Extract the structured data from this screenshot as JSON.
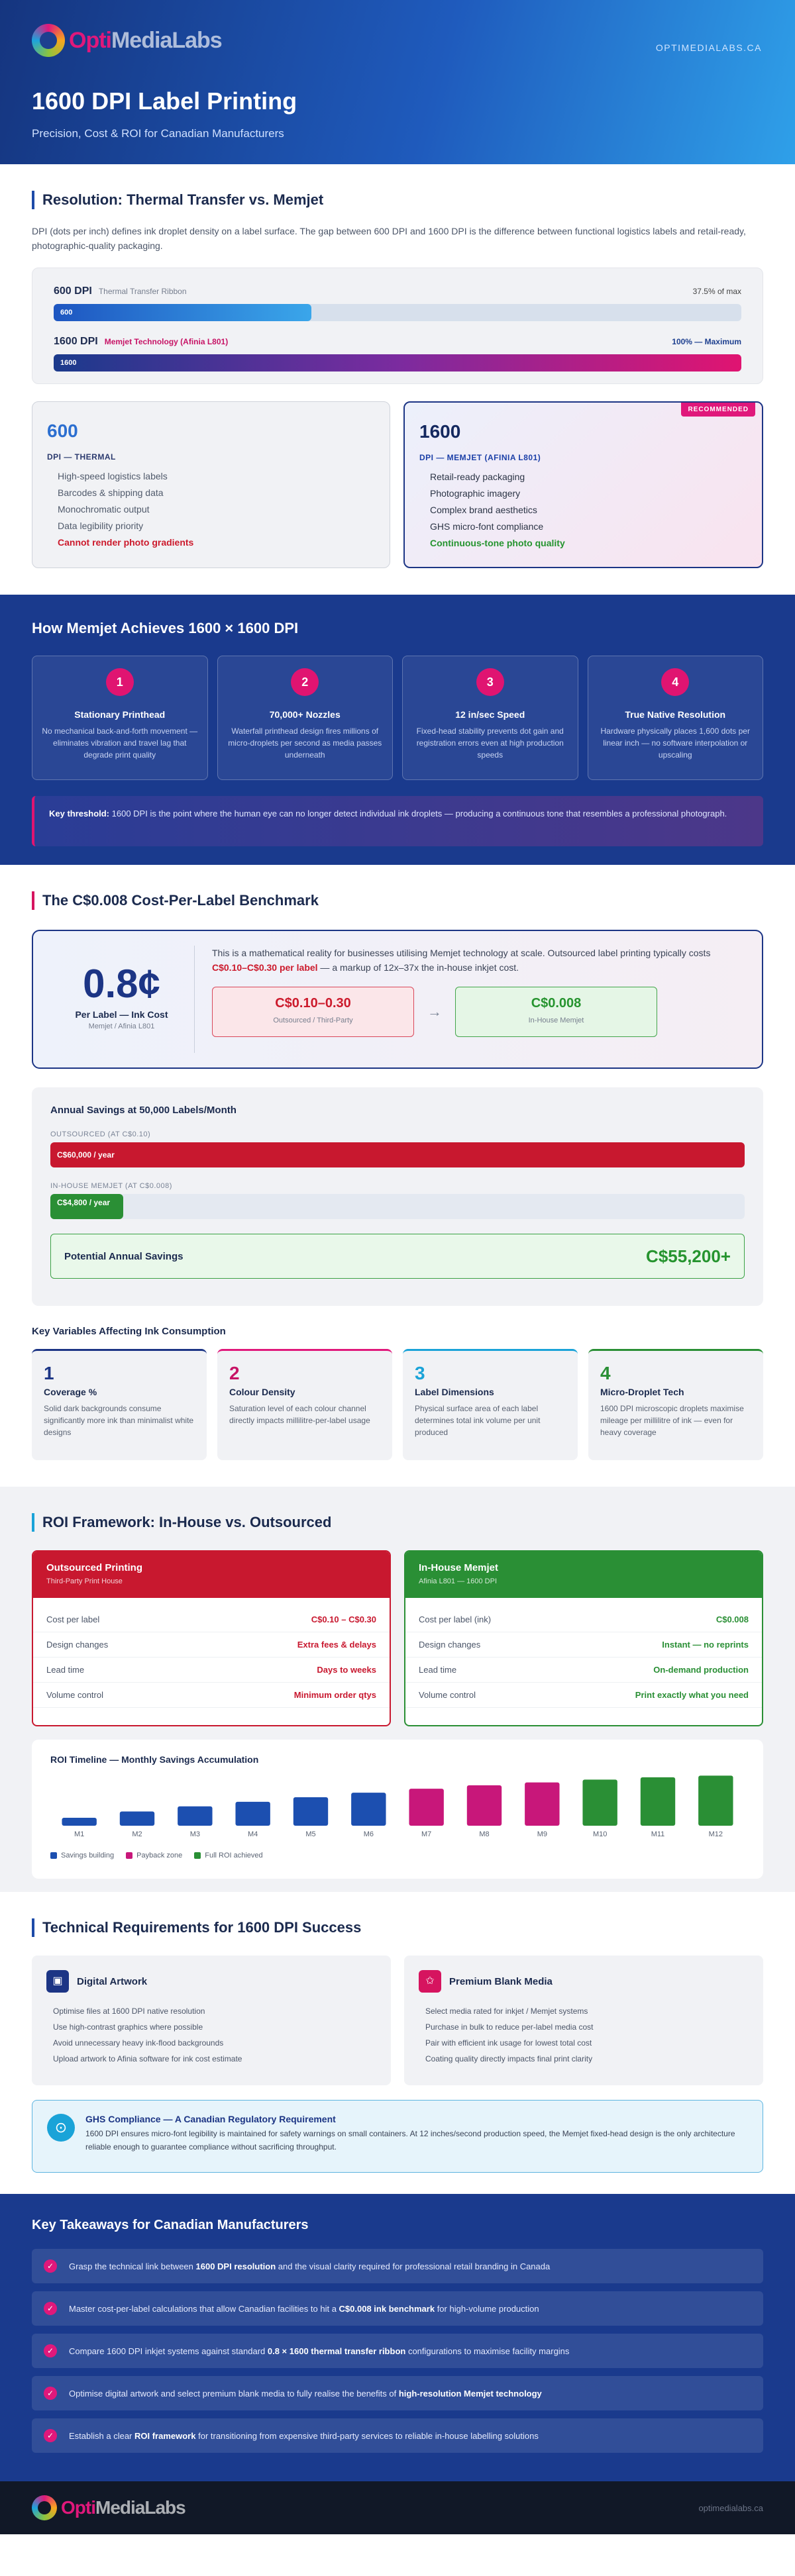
{
  "brand": {
    "logo_a": "Opti",
    "logo_b": "MediaLabs",
    "url": "OPTIMEDIALABS.CA",
    "footer_url": "optimedialabs.ca"
  },
  "hero": {
    "title": "1600 DPI Label Printing",
    "subtitle": "Precision, Cost & ROI for Canadian Manufacturers"
  },
  "resolution": {
    "heading": "Resolution: Thermal Transfer vs. Memjet",
    "intro": "DPI (dots per inch) defines ink droplet density on a label surface. The gap between 600 DPI and 1600 DPI is the difference between functional logistics labels and retail-ready, photographic-quality packaging.",
    "bars": [
      {
        "label": "600 DPI",
        "sub": "Thermal Transfer Ribbon",
        "right": "37.5% of max",
        "fill_text": "600",
        "fraction": 0.375
      },
      {
        "label": "1600 DPI",
        "sub": "Memjet Technology (Afinia L801)",
        "right": "100% — Maximum",
        "fill_text": "1600",
        "fraction": 1.0
      }
    ],
    "card600": {
      "num": "600",
      "tag": "DPI — THERMAL",
      "items": [
        "High-speed logistics labels",
        "Barcodes & shipping data",
        "Monochromatic output",
        "Data legibility priority"
      ],
      "bad": "Cannot render photo gradients"
    },
    "card1600": {
      "ribbon": "RECOMMENDED",
      "num": "1600",
      "tag": "DPI — MEMJET (AFINIA L801)",
      "items": [
        "Retail-ready packaging",
        "Photographic imagery",
        "Complex brand aesthetics",
        "GHS micro-font compliance"
      ],
      "good": "Continuous-tone photo quality"
    }
  },
  "memjet": {
    "heading": "How Memjet Achieves 1600 × 1600 DPI",
    "steps": [
      {
        "n": "1",
        "title": "Stationary Printhead",
        "desc": "No mechanical back-and-forth movement — eliminates vibration and travel lag that degrade print quality"
      },
      {
        "n": "2",
        "title": "70,000+ Nozzles",
        "desc": "Waterfall printhead design fires millions of micro-droplets per second as media passes underneath"
      },
      {
        "n": "3",
        "title": "12 in/sec Speed",
        "desc": "Fixed-head stability prevents dot gain and registration errors even at high production speeds"
      },
      {
        "n": "4",
        "title": "True Native Resolution",
        "desc": "Hardware physically places 1,600 dots per linear inch — no software interpolation or upscaling"
      }
    ],
    "threshold_label": "Key threshold:",
    "threshold_text": "1600 DPI is the point where the human eye can no longer detect individual ink droplets — producing a continuous tone that resembles a professional photograph."
  },
  "cost": {
    "heading": "The C$0.008 Cost-Per-Label Benchmark",
    "big": "0.8¢",
    "big_label": "Per Label — Ink Cost",
    "big_sub": "Memjet / Afinia L801",
    "text_a": "This is a mathematical reality for businesses utilising Memjet technology at scale. Outsourced label printing typically costs ",
    "text_hl": "C$0.10–C$0.30 per label",
    "text_b": " — a markup of 12x–37x the in-house inkjet cost.",
    "out_value": "C$0.10–0.30",
    "out_label": "Outsourced / Third-Party",
    "arrow": "→",
    "in_value": "C$0.008",
    "in_label": "In-House Memjet",
    "savings": {
      "title": "Annual Savings at 50,000 Labels/Month",
      "out_label": "OUTSOURCED (AT C$0.10)",
      "out_bar": "C$60,000 / year",
      "out_fraction": 1.0,
      "in_label": "IN-HOUSE MEMJET (AT C$0.008)",
      "in_bar": "C$4,800 / year",
      "in_fraction": 0.08,
      "potential_label": "Potential Annual Savings",
      "potential_value": "C$55,200+"
    },
    "kv_heading": "Key Variables Affecting Ink Consumption",
    "variables": [
      {
        "n": "1",
        "title": "Coverage %",
        "desc": "Solid dark backgrounds consume significantly more ink than minimalist white designs"
      },
      {
        "n": "2",
        "title": "Colour Density",
        "desc": "Saturation level of each colour channel directly impacts millilitre-per-label usage"
      },
      {
        "n": "3",
        "title": "Label Dimensions",
        "desc": "Physical surface area of each label determines total ink volume per unit produced"
      },
      {
        "n": "4",
        "title": "Micro-Droplet Tech",
        "desc": "1600 DPI microscopic droplets maximise mileage per millilitre of ink — even for heavy coverage"
      }
    ]
  },
  "roi": {
    "heading": "ROI Framework: In-House vs. Outsourced",
    "outsourced": {
      "title": "Outsourced Printing",
      "sub": "Third-Party Print House",
      "rows": [
        [
          "Cost per label",
          "C$0.10 – C$0.30"
        ],
        [
          "Design changes",
          "Extra fees & delays"
        ],
        [
          "Lead time",
          "Days to weeks"
        ],
        [
          "Volume control",
          "Minimum order qtys"
        ]
      ]
    },
    "inhouse": {
      "title": "In-House Memjet",
      "sub": "Afinia L801 — 1600 DPI",
      "rows": [
        [
          "Cost per label (ink)",
          "C$0.008"
        ],
        [
          "Design changes",
          "Instant — no reprints"
        ],
        [
          "Lead time",
          "On-demand production"
        ],
        [
          "Volume control",
          "Print exactly what you need"
        ]
      ]
    },
    "timeline_title": "ROI Timeline — Monthly Savings Accumulation",
    "legend": [
      "Savings building",
      "Payback zone",
      "Full ROI achieved"
    ],
    "colors": {
      "building": "#1c4fb0",
      "payback": "#c8177a",
      "full": "#2a8f35"
    }
  },
  "chart_data": {
    "type": "bar",
    "title": "ROI Timeline — Monthly Savings Accumulation",
    "categories": [
      "M1",
      "M2",
      "M3",
      "M4",
      "M5",
      "M6",
      "M7",
      "M8",
      "M9",
      "M10",
      "M11",
      "M12"
    ],
    "values": [
      14,
      25,
      34,
      42,
      50,
      58,
      65,
      71,
      76,
      81,
      85,
      88
    ],
    "phase": [
      "building",
      "building",
      "building",
      "building",
      "building",
      "building",
      "payback",
      "payback",
      "payback",
      "full",
      "full",
      "full"
    ],
    "ylim": [
      0,
      100
    ],
    "legend_position": "bottom-left"
  },
  "tech": {
    "heading": "Technical Requirements for 1600 DPI Success",
    "artwork": {
      "icon": "▣",
      "title": "Digital Artwork",
      "items": [
        "Optimise files at 1600 DPI native resolution",
        "Use high-contrast graphics where possible",
        "Avoid unnecessary heavy ink-flood backgrounds",
        "Upload artwork to Afinia software for ink cost estimate"
      ]
    },
    "media": {
      "icon": "✩",
      "title": "Premium Blank Media",
      "items": [
        "Select media rated for inkjet / Memjet systems",
        "Purchase in bulk to reduce per-label media cost",
        "Pair with efficient ink usage for lowest total cost",
        "Coating quality directly impacts final print clarity"
      ]
    },
    "ghs": {
      "icon": "⊙",
      "title": "GHS Compliance — A Canadian Regulatory Requirement",
      "desc": "1600 DPI ensures micro-font legibility is maintained for safety warnings on small containers. At 12 inches/second production speed, the Memjet fixed-head design is the only architecture reliable enough to guarantee compliance without sacrificing throughput."
    }
  },
  "takeaways": {
    "heading": "Key Takeaways for Canadian Manufacturers",
    "check": "✓",
    "items": [
      {
        "a": "Grasp the technical link between ",
        "b": "1600 DPI resolution",
        "c": " and the visual clarity required for professional retail branding in Canada"
      },
      {
        "a": "Master cost-per-label calculations that allow Canadian facilities to hit a ",
        "b": "C$0.008 ink benchmark",
        "c": " for high-volume production"
      },
      {
        "a": "Compare 1600 DPI inkjet systems against standard ",
        "b": "0.8 × 1600 thermal transfer ribbon",
        "c": " configurations to maximise facility margins"
      },
      {
        "a": "Optimise digital artwork and select premium blank media to fully realise the benefits of ",
        "b": "high-resolution Memjet technology",
        "c": ""
      },
      {
        "a": "Establish a clear ",
        "b": "ROI framework",
        "c": " for transitioning from expensive third-party services to reliable in-house labelling solutions"
      }
    ]
  }
}
